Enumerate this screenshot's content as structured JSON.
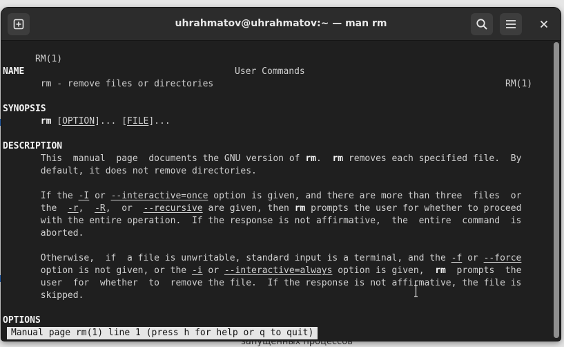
{
  "window": {
    "title": "uhrahmatov@uhrahmatov:~ — man rm",
    "new_tab_icon": "new-tab-icon",
    "search_icon": "search-icon",
    "menu_icon": "hamburger-menu-icon",
    "close_icon": "close-icon"
  },
  "background": {
    "partial_text": "запущенных процессов",
    "accent": "#2a6fc9"
  },
  "man": {
    "header": {
      "left": "RM(1)",
      "center": "User Commands",
      "right": "RM(1)"
    },
    "name_heading": "NAME",
    "name_text": "rm - remove files or directories",
    "synopsis_heading": "SYNOPSIS",
    "synopsis": {
      "cmd": "rm",
      "open1": "[",
      "option": "OPTION",
      "close1": "]... ",
      "open2": "[",
      "file": "FILE",
      "close2": "]..."
    },
    "description_heading": "DESCRIPTION",
    "d1": {
      "a": "This  manual  page  documents the GNU version of ",
      "rm1": "rm",
      "b": ".  ",
      "rm2": "rm",
      "c": " removes each specified file.  By",
      "l2": "default, it does not remove directories."
    },
    "d2": {
      "a": "If the ",
      "opt_I": "-I",
      "b": " or ",
      "opt_interactive_once": "--interactive=once",
      "c": " option is given, and there are more than three  files  or",
      "d": "the  ",
      "opt_r": "-r",
      "e": ",  ",
      "opt_R": "-R",
      "f": ",  or  ",
      "opt_recursive": "--recursive",
      "g": " are given, then ",
      "rm": "rm",
      "h": " prompts the user for whether to proceed",
      "l3": "with the entire operation.  If the response is not affirmative,  the  entire  command  is",
      "l4": "aborted."
    },
    "d3": {
      "a": "Otherwise,  if  a file is unwritable, standard input is a terminal, and the ",
      "opt_f": "-f",
      "b": " or ",
      "opt_force": "--force",
      "c": "option is not given, or the ",
      "opt_i": "-i",
      "d": " or ",
      "opt_interactive_always": "--interactive=always",
      "e": " option is given,  ",
      "rm": "rm",
      "f": "  prompts  the",
      "l3": "user  for  whether  to  remove the file.  If the response is not affirmative, the file is",
      "l4": "skipped."
    },
    "options_heading": "OPTIONS"
  },
  "status": "Manual page rm(1) line 1 (press h for help or q to quit)",
  "colors": {
    "terminal_bg": "#1f1f1f",
    "text": "#d0d0d0",
    "bold_text": "#f2f2f2",
    "header_bg": "#2c2c2c",
    "status_bg": "#e6e6e6"
  }
}
